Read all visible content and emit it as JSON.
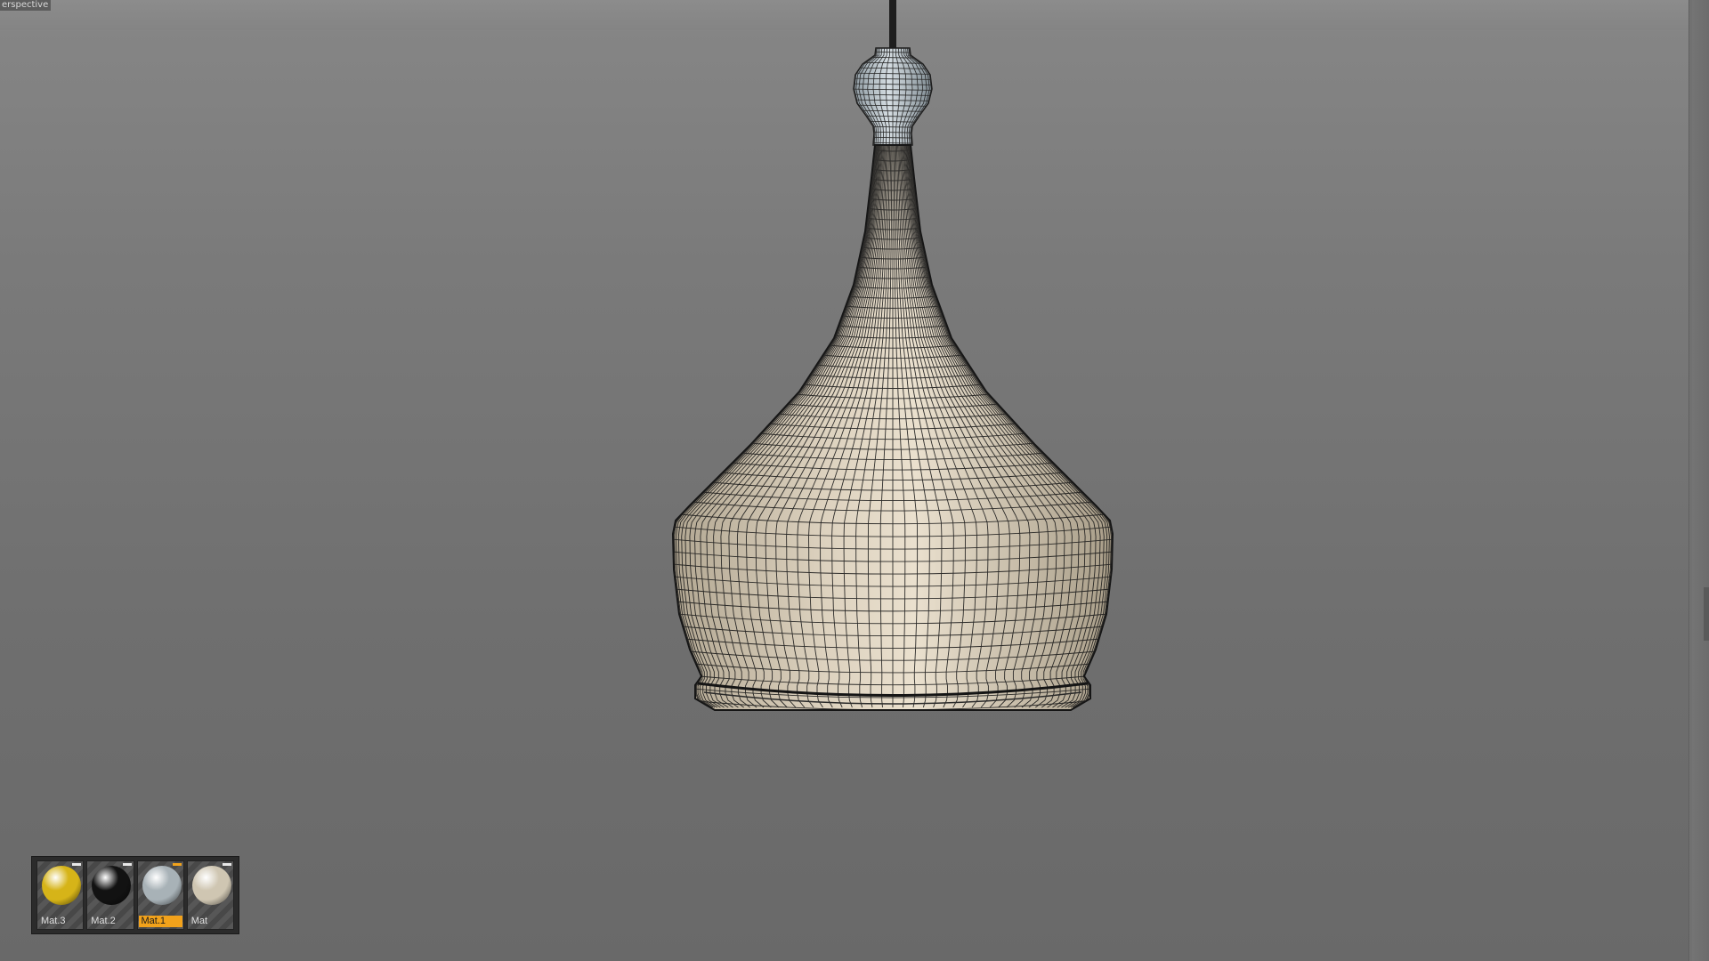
{
  "viewport": {
    "view_name": "erspective",
    "background_color": "#7a7a7a"
  },
  "model": {
    "type": "pendant-lamp-wireframe",
    "shade_color": "#d9cdb7",
    "cap_color": "#b9c3ca",
    "cord_color": "#1e1e1e",
    "wire_color": "#1a1a1a"
  },
  "material_manager": {
    "materials": [
      {
        "label": "Mat.3",
        "color": "#d6b418",
        "selected": false,
        "icon": "sphere-swatch-icon"
      },
      {
        "label": "Mat.2",
        "color": "#121212",
        "selected": false,
        "icon": "sphere-swatch-icon"
      },
      {
        "label": "Mat.1",
        "color": "#a8b2b7",
        "selected": true,
        "icon": "sphere-swatch-icon"
      },
      {
        "label": "Mat",
        "color": "#cfc6b2",
        "selected": false,
        "icon": "sphere-swatch-icon"
      }
    ],
    "selected_color": "#f2a21b"
  }
}
